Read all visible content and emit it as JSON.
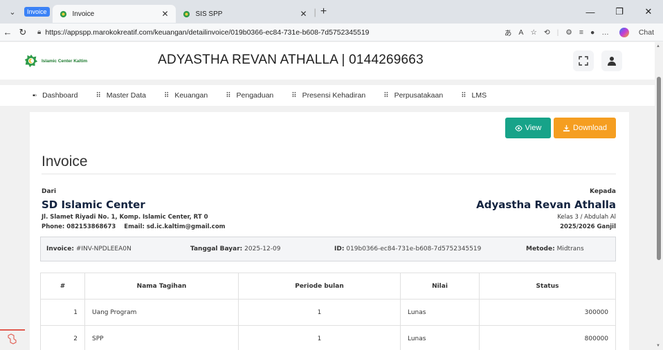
{
  "browser": {
    "tab_group_label": "Invoice",
    "tabs": [
      {
        "title": "Invoice",
        "active": true
      },
      {
        "title": "SIS SPP",
        "active": false
      }
    ],
    "url": "https://appspp.marokokreatif.com/keuangan/detailinvoice/019b0366-ec84-731e-b608-7d5752345519",
    "copilot_label": "Chat"
  },
  "app": {
    "logo_text": "Islamic Center Kaltim",
    "student_title": "ADYASTHA REVAN ATHALLA | 0144269663",
    "menu": [
      {
        "label": "Dashboard"
      },
      {
        "label": "Master Data"
      },
      {
        "label": "Keuangan"
      },
      {
        "label": "Pengaduan"
      },
      {
        "label": "Presensi Kehadiran"
      },
      {
        "label": "Perpusatakaan"
      },
      {
        "label": "LMS"
      }
    ]
  },
  "invoice": {
    "view_label": "View",
    "download_label": "Download",
    "heading": "Invoice",
    "from": {
      "label": "Dari",
      "name": "SD Islamic Center",
      "address": "Jl. Slamet Riyadi No. 1, Komp. Islamic Center, RT 0",
      "phone": "Phone: 082153868673",
      "email": "Email: sd.ic.kaltim@gmail.com"
    },
    "to": {
      "label": "Kepada",
      "name": "Adyastha Revan Athalla",
      "class": "Kelas 3 / Abdulah Al",
      "period": "2025/2026 Ganjil"
    },
    "meta": {
      "invoice_label": "Invoice:",
      "invoice_value": "#INV-NPDLEEA0N",
      "date_label": "Tanggal Bayar:",
      "date_value": "2025-12-09",
      "id_label": "ID:",
      "id_value": "019b0366-ec84-731e-b608-7d5752345519",
      "method_label": "Metode:",
      "method_value": "Midtrans"
    },
    "table": {
      "headers": [
        "#",
        "Nama Tagihan",
        "Periode bulan",
        "Nilai",
        "Status"
      ],
      "rows": [
        [
          "1",
          "Uang Program",
          "1",
          "Lunas",
          "300000"
        ],
        [
          "2",
          "SPP",
          "1",
          "Lunas",
          "800000"
        ]
      ]
    }
  }
}
